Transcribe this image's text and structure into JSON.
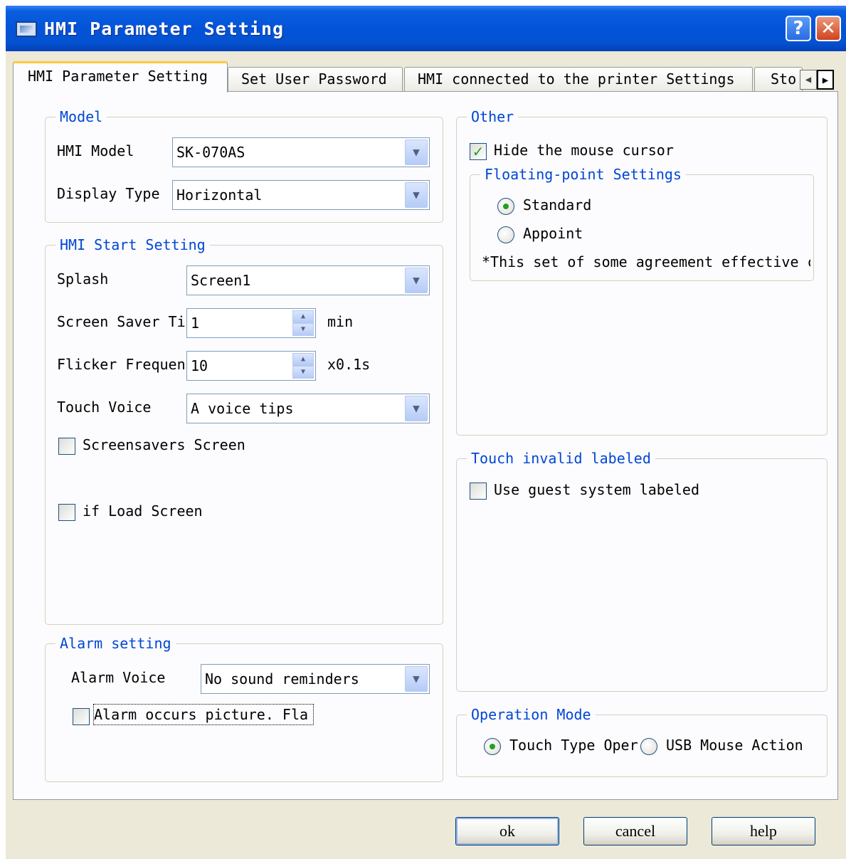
{
  "window": {
    "title": "HMI Parameter Setting",
    "help_glyph": "?",
    "close_glyph": "✕"
  },
  "tabs": {
    "items": [
      {
        "label": "HMI Parameter Setting",
        "active": true
      },
      {
        "label": "Set User Password",
        "active": false
      },
      {
        "label": "HMI connected to the printer Settings",
        "active": false
      },
      {
        "label": "Sto",
        "active": false
      }
    ],
    "scroll_left": "◀",
    "scroll_right": "▶"
  },
  "model": {
    "legend": "Model",
    "hmi_model_label": "HMI Model",
    "hmi_model_value": "SK-070AS",
    "display_type_label": "Display Type",
    "display_type_value": "Horizontal"
  },
  "start": {
    "legend": "HMI Start Setting",
    "splash_label": "Splash",
    "splash_value": "Screen1",
    "saver_label": "Screen Saver Ti",
    "saver_value": "1",
    "saver_unit": "min",
    "flicker_label": "Flicker Frequen",
    "flicker_value": "10",
    "flicker_unit": "x0.1s",
    "touch_voice_label": "Touch Voice",
    "touch_voice_value": "A voice tips",
    "screensavers_label": "Screensavers Screen",
    "screensavers_checked": false,
    "load_screen_label": "if Load Screen",
    "load_screen_checked": false
  },
  "alarm": {
    "legend": "Alarm setting",
    "voice_label": "Alarm Voice",
    "voice_value": "No sound reminders",
    "occurs_label": "Alarm occurs picture. Fla",
    "occurs_checked": false
  },
  "other": {
    "legend": "Other",
    "hide_cursor_label": "Hide the mouse cursor",
    "hide_cursor_checked": true,
    "check_glyph": "✓",
    "float_legend": "Floating-point Settings",
    "standard_label": "Standard",
    "appoint_label": "Appoint",
    "selected": "Standard",
    "note": "*This set of some agreement effective c"
  },
  "touch_invalid": {
    "legend": "Touch invalid labeled",
    "guest_label": "Use guest system labeled",
    "guest_checked": false
  },
  "operation": {
    "legend": "Operation Mode",
    "touch_label": "Touch Type Oper",
    "usb_label": "USB Mouse Action",
    "selected": "Touch Type Oper"
  },
  "buttons": {
    "ok": "ok",
    "cancel": "cancel",
    "help": "help"
  },
  "icons": {
    "dropdown_arrow": "▼",
    "spin_up": "▲",
    "spin_down": "▼"
  },
  "colors": {
    "titlebar": "#0353d8",
    "legend_text": "#0046d5",
    "check_mark": "#21a121",
    "dialog_bg": "#ece9d8",
    "active_tab_accent": "#ffc83c"
  }
}
